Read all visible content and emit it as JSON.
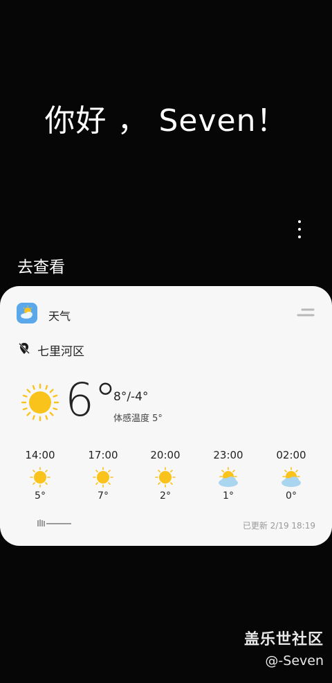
{
  "greeting": "你好 ， Seven！",
  "goto_label": "去查看",
  "widget": {
    "app_title": "天气",
    "app_icon": "weather-app-icon",
    "location": "七里河区",
    "current_temp": "6°",
    "range": "8°/-4°",
    "feels_like": "体感温度 5°",
    "current_icon": "sunny-icon",
    "hourly": [
      {
        "time": "14:00",
        "temp": "5°",
        "icon": "sunny-icon"
      },
      {
        "time": "17:00",
        "temp": "7°",
        "icon": "sunny-icon"
      },
      {
        "time": "20:00",
        "temp": "2°",
        "icon": "sunny-icon"
      },
      {
        "time": "23:00",
        "temp": "1°",
        "icon": "partly-cloudy-icon"
      },
      {
        "time": "02:00",
        "temp": "0°",
        "icon": "partly-cloudy-icon"
      }
    ],
    "provider_logo": "weathernews-logo",
    "updated": "已更新 2/19 18:19"
  },
  "watermark": {
    "title": "盖乐世社区",
    "user": "@-Seven"
  },
  "colors": {
    "background": "#060606",
    "card": "#f7f7f7",
    "sun": "#f9c31c",
    "cloud": "#a9d5ef",
    "app_icon_bg": "#5aa7ea"
  }
}
